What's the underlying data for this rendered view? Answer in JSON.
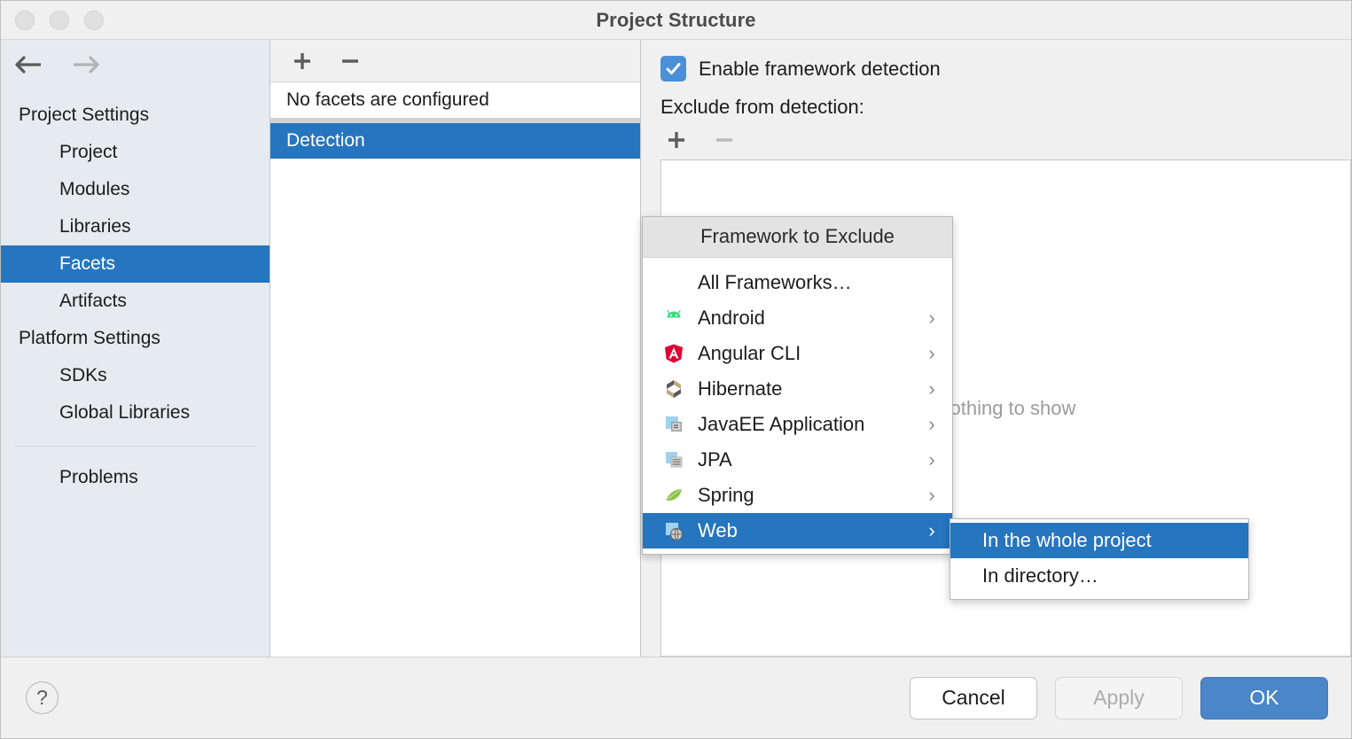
{
  "window": {
    "title": "Project Structure",
    "traffic_lights": [
      "close-button",
      "minimize-button",
      "zoom-button"
    ]
  },
  "nav": {
    "back_icon": "arrow-left-icon",
    "forward_icon": "arrow-right-icon"
  },
  "sidebar": {
    "groups": [
      {
        "label": "Project Settings",
        "items": [
          {
            "label": "Project",
            "selected": false
          },
          {
            "label": "Modules",
            "selected": false
          },
          {
            "label": "Libraries",
            "selected": false
          },
          {
            "label": "Facets",
            "selected": true
          },
          {
            "label": "Artifacts",
            "selected": false
          }
        ]
      },
      {
        "label": "Platform Settings",
        "items": [
          {
            "label": "SDKs",
            "selected": false
          },
          {
            "label": "Global Libraries",
            "selected": false
          }
        ]
      }
    ],
    "footer_items": [
      {
        "label": "Problems",
        "selected": false
      }
    ]
  },
  "facets_panel": {
    "toolbar": {
      "add_label": "+",
      "remove_label": "−"
    },
    "rows": [
      {
        "label": "No facets are configured",
        "selected": false
      },
      {
        "label": "Detection",
        "selected": true
      }
    ]
  },
  "detail_panel": {
    "enable_detection_label": "Enable framework detection",
    "enable_detection_checked": true,
    "exclude_label": "Exclude from detection:",
    "toolbar": {
      "add_label": "+",
      "remove_label": "−"
    },
    "empty_text": "Nothing to show"
  },
  "context_menu": {
    "header": "Framework to Exclude",
    "items": [
      {
        "label": "All Frameworks…",
        "icon": "none",
        "has_submenu": false,
        "selected": false
      },
      {
        "label": "Android",
        "icon": "android-icon",
        "has_submenu": true,
        "selected": false
      },
      {
        "label": "Angular CLI",
        "icon": "angular-icon",
        "has_submenu": true,
        "selected": false
      },
      {
        "label": "Hibernate",
        "icon": "hibernate-icon",
        "has_submenu": true,
        "selected": false
      },
      {
        "label": "JavaEE Application",
        "icon": "javaee-icon",
        "has_submenu": true,
        "selected": false
      },
      {
        "label": "JPA",
        "icon": "jpa-icon",
        "has_submenu": true,
        "selected": false
      },
      {
        "label": "Spring",
        "icon": "spring-icon",
        "has_submenu": true,
        "selected": false
      },
      {
        "label": "Web",
        "icon": "web-icon",
        "has_submenu": true,
        "selected": true
      }
    ],
    "submenu_arrow": "›"
  },
  "submenu": {
    "items": [
      {
        "label": "In the whole project",
        "selected": true
      },
      {
        "label": "In directory…",
        "selected": false
      }
    ]
  },
  "footer": {
    "help_label": "?",
    "cancel_label": "Cancel",
    "apply_label": "Apply",
    "ok_label": "OK"
  },
  "colors": {
    "selection_blue": "#2675bf",
    "primary_button_blue": "#4a86c8",
    "checkbox_blue": "#4a90d9",
    "sidebar_bg": "#e6ebef",
    "panel_bg": "#f0f0f0"
  }
}
